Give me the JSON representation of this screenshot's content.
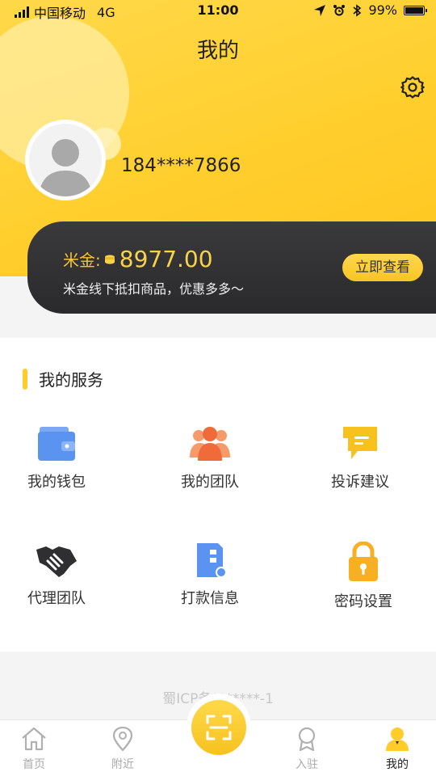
{
  "status_bar": {
    "carrier": "中国移动",
    "network": "4G",
    "time": "11:00",
    "battery": "99%"
  },
  "header": {
    "title": "我的",
    "phone": "184****7866"
  },
  "wallet_card": {
    "label": "米金:",
    "amount": "8977.00",
    "description": "米金线下抵扣商品，优惠多多～",
    "button": "立即查看"
  },
  "services": {
    "title": "我的服务",
    "items": [
      {
        "label": "我的钱包",
        "icon": "wallet-icon"
      },
      {
        "label": "我的团队",
        "icon": "team-icon"
      },
      {
        "label": "投诉建议",
        "icon": "feedback-icon"
      },
      {
        "label": "代理团队",
        "icon": "handshake-icon"
      },
      {
        "label": "打款信息",
        "icon": "payment-doc-icon"
      },
      {
        "label": "密码设置",
        "icon": "lock-icon"
      }
    ]
  },
  "footer": {
    "icp": "蜀ICP备*******-1"
  },
  "tabbar": {
    "items": [
      {
        "label": "首页",
        "icon": "home-icon"
      },
      {
        "label": "附近",
        "icon": "location-icon"
      },
      {
        "label": "",
        "icon": "scan-icon"
      },
      {
        "label": "入驻",
        "icon": "badge-icon"
      },
      {
        "label": "我的",
        "icon": "person-icon"
      }
    ],
    "active": "我的"
  },
  "colors": {
    "accent": "#ffcc2a",
    "card": "#2f2f31",
    "gold_text": "#f8d34a"
  }
}
